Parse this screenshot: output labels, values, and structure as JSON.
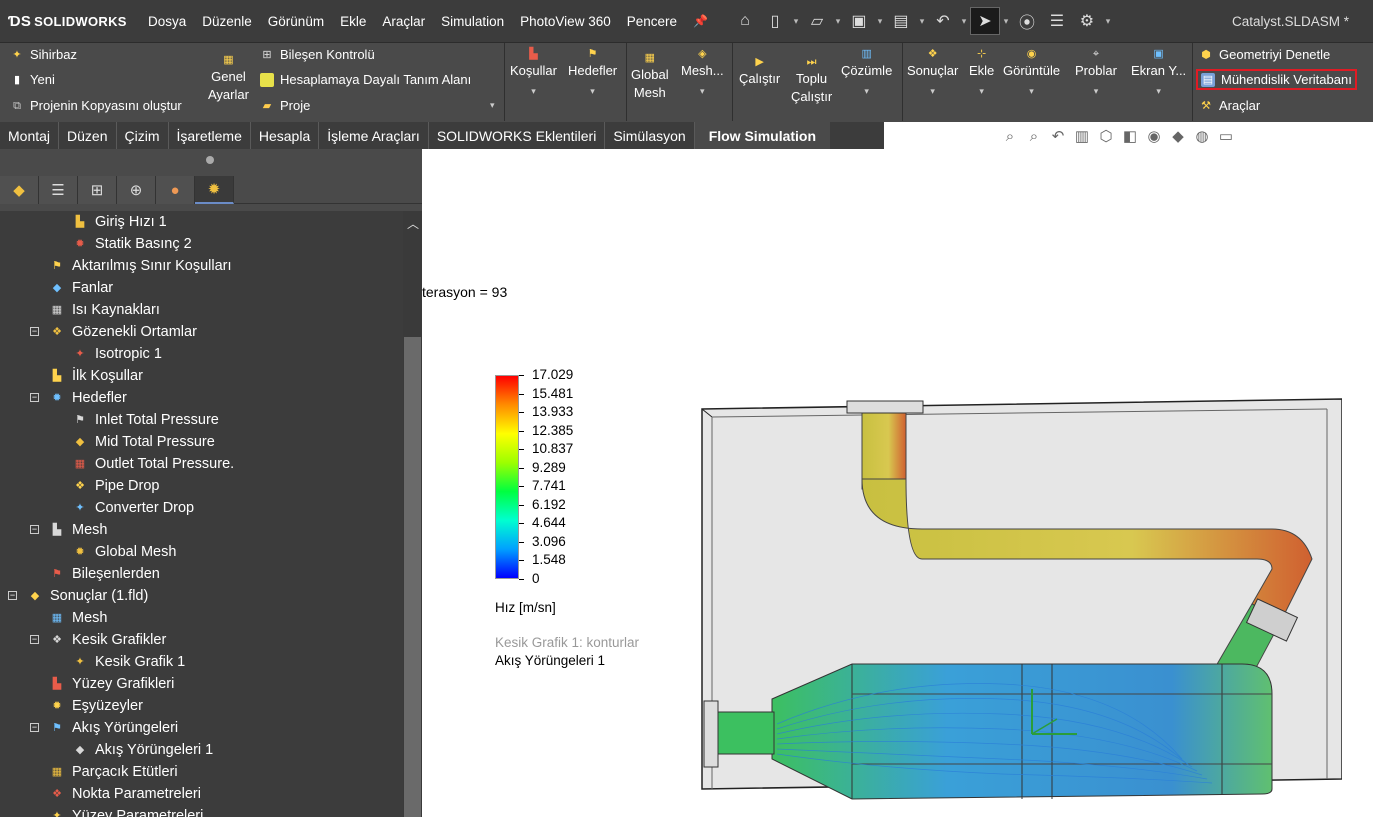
{
  "app": {
    "logo": "SOLIDWORKS",
    "document": "Catalyst.SLDASM *"
  },
  "menu": [
    "Dosya",
    "Düzenle",
    "Görünüm",
    "Ekle",
    "Araçlar",
    "Simulation",
    "PhotoView 360",
    "Pencere"
  ],
  "ribbon": {
    "wizard": "Sihirbaz",
    "new": "Yeni",
    "clone": "Projenin Kopyasını oluştur",
    "general_1": "Genel",
    "general_2": "Ayarlar",
    "component_control": "Bileşen Kontrolü",
    "calc_domain": "Hesaplamaya Dayalı Tanım Alanı",
    "project": "Proje",
    "conditions": "Koşullar",
    "goals": "Hedefler",
    "global_mesh_1": "Global",
    "global_mesh_2": "Mesh",
    "mesh": "Mesh...",
    "run": "Çalıştır",
    "batch_run_1": "Toplu",
    "batch_run_2": "Çalıştır",
    "solve": "Çözümle",
    "results": "Sonuçlar",
    "insert": "Ekle",
    "display": "Görüntüle",
    "probe": "Problar",
    "screen": "Ekran Y...",
    "check_geometry": "Geometriyi Denetle",
    "engineering_db": "Mühendislik Veritabanı",
    "tools": "Araçlar"
  },
  "tabs": [
    "Montaj",
    "Düzen",
    "Çizim",
    "İşaretleme",
    "Hesapla",
    "İşleme Araçları",
    "SOLIDWORKS Eklentileri",
    "Simülasyon",
    "Flow Simulation"
  ],
  "active_tab": "Flow Simulation",
  "tree": [
    {
      "label": "Giriş Hızı 1",
      "level": 3
    },
    {
      "label": "Statik Basınç 2",
      "level": 3
    },
    {
      "label": "Aktarılmış Sınır Koşulları",
      "level": 2
    },
    {
      "label": "Fanlar",
      "level": 2
    },
    {
      "label": "Isı Kaynakları",
      "level": 2
    },
    {
      "label": "Gözenekli Ortamlar",
      "level": 2,
      "expanded": true
    },
    {
      "label": "Isotropic 1",
      "level": 3
    },
    {
      "label": "İlk Koşullar",
      "level": 2
    },
    {
      "label": "Hedefler",
      "level": 2,
      "expanded": true
    },
    {
      "label": "Inlet Total Pressure",
      "level": 3
    },
    {
      "label": "Mid Total Pressure",
      "level": 3
    },
    {
      "label": "Outlet Total Pressure.",
      "level": 3
    },
    {
      "label": "Pipe Drop",
      "level": 3
    },
    {
      "label": "Converter Drop",
      "level": 3
    },
    {
      "label": "Mesh",
      "level": 2,
      "expanded": true
    },
    {
      "label": "Global Mesh",
      "level": 3
    },
    {
      "label": "Bileşenlerden",
      "level": 2
    },
    {
      "label": "Sonuçlar (1.fld)",
      "level": 1,
      "expanded": true
    },
    {
      "label": "Mesh",
      "level": 2
    },
    {
      "label": "Kesik Grafikler",
      "level": 2,
      "expanded": true
    },
    {
      "label": "Kesik Grafik 1",
      "level": 3
    },
    {
      "label": "Yüzey Grafikleri",
      "level": 2
    },
    {
      "label": "Eşyüzeyler",
      "level": 2
    },
    {
      "label": "Akış Yörüngeleri",
      "level": 2,
      "expanded": true
    },
    {
      "label": "Akış Yörüngeleri 1",
      "level": 3
    },
    {
      "label": "Parçacık Etütleri",
      "level": 2
    },
    {
      "label": "Nokta Parametreleri",
      "level": 2
    },
    {
      "label": "Yüzey Parametreleri",
      "level": 2
    }
  ],
  "graphics": {
    "iteration": "terasyon = 93",
    "legend_values": [
      "17.029",
      "15.481",
      "13.933",
      "12.385",
      "10.837",
      "9.289",
      "7.741",
      "6.192",
      "4.644",
      "3.096",
      "1.548",
      "0"
    ],
    "unit": "Hız [m/sn]",
    "cut_plot": "Kesik Grafik 1: konturlar",
    "trajectories": "Akış Yörüngeleri 1"
  },
  "colors": {
    "highlight": "#e01b24",
    "panel": "#3c3c3c",
    "ribbon": "#4a4a4a"
  }
}
